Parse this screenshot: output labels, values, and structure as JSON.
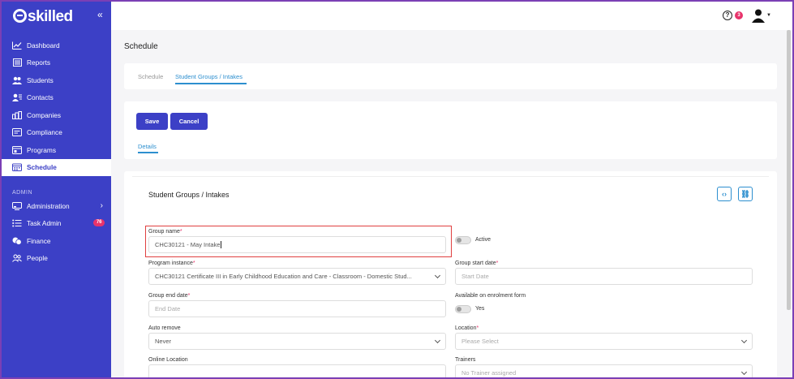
{
  "brand": {
    "logo_text": "skilled",
    "accent": "#3c40c6",
    "badge_color": "#e8336b",
    "link_color": "#2d8fcf"
  },
  "sidebar": {
    "items": [
      {
        "label": "Dashboard",
        "icon": "chart-line-icon"
      },
      {
        "label": "Reports",
        "icon": "reports-icon"
      },
      {
        "label": "Students",
        "icon": "users-icon"
      },
      {
        "label": "Contacts",
        "icon": "contacts-icon"
      },
      {
        "label": "Companies",
        "icon": "building-icon"
      },
      {
        "label": "Compliance",
        "icon": "compliance-icon"
      },
      {
        "label": "Programs",
        "icon": "programs-icon"
      },
      {
        "label": "Schedule",
        "icon": "calendar-icon",
        "active": true
      }
    ],
    "admin_label": "ADMIN",
    "admin_items": [
      {
        "label": "Administration",
        "icon": "monitor-icon"
      },
      {
        "label": "Task Admin",
        "icon": "list-icon",
        "badge": "76"
      },
      {
        "label": "Finance",
        "icon": "coins-icon"
      },
      {
        "label": "People",
        "icon": "people-icon"
      }
    ]
  },
  "topbar": {
    "help_glyph": "?",
    "notifications": "3"
  },
  "page": {
    "title": "Schedule"
  },
  "tabs": {
    "schedule": "Schedule",
    "groups": "Student Groups / Intakes"
  },
  "actions": {
    "save": "Save",
    "cancel": "Cancel",
    "details_tab": "Details"
  },
  "form": {
    "title": "Student Groups / Intakes",
    "code_glyph": "‹›",
    "link_glyph": "⛓",
    "group_name_label": "Group name",
    "group_name_value": "CHC30121 - May Intake",
    "active_label": "Active",
    "program_instance_label": "Program instance",
    "program_instance_value": "CHC30121 Certificate III in Early Childhood Education and Care - Classroom - Domestic Stud...",
    "group_start_label": "Group start date",
    "group_start_placeholder": "Start Date",
    "group_end_label": "Group end date",
    "group_end_placeholder": "End Date",
    "enrolment_label": "Available on enrolment form",
    "enrolment_toggle_label": "Yes",
    "auto_remove_label": "Auto remove",
    "auto_remove_value": "Never",
    "location_label": "Location",
    "location_placeholder": "Please Select",
    "online_location_label": "Online Location",
    "trainers_label": "Trainers",
    "trainers_placeholder": "No Trainer assigned",
    "required_mark": "*"
  }
}
